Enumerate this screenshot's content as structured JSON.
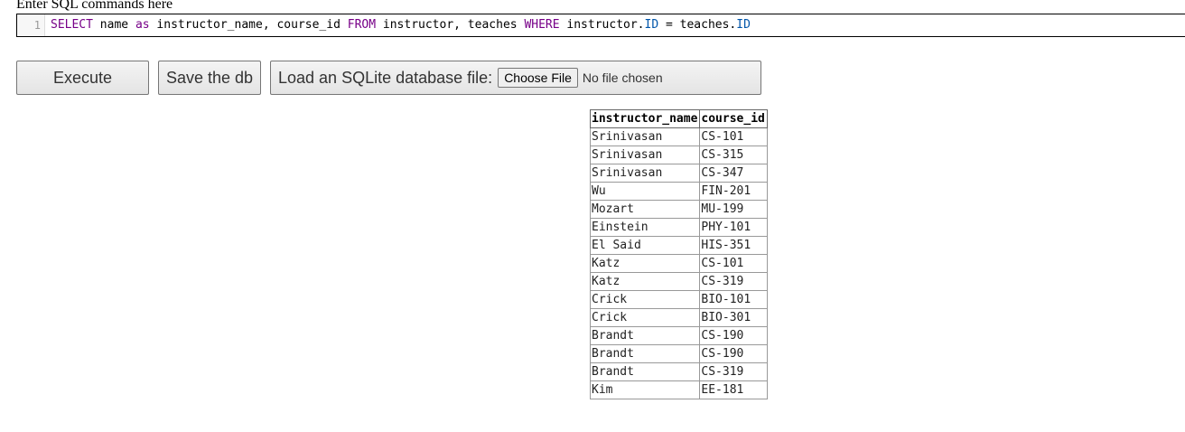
{
  "editor_label": "Enter SQL commands here",
  "editor": {
    "line_number": "1",
    "tokens": {
      "t1": "SELECT",
      "t2": " name ",
      "t3": "as",
      "t4": " instructor_name, course_id ",
      "t5": "FROM",
      "t6": " instructor, teaches ",
      "t7": "WHERE",
      "t8": " instructor.",
      "t9": "ID",
      "t10": " = teaches.",
      "t11": "ID"
    }
  },
  "toolbar": {
    "execute_label": "Execute",
    "save_label": "Save the db",
    "load_label": "Load an SQLite database file:",
    "choose_file_label": "Choose File",
    "file_status": "No file chosen"
  },
  "results": {
    "columns": [
      "instructor_name",
      "course_id"
    ],
    "rows": [
      [
        "Srinivasan",
        "CS-101"
      ],
      [
        "Srinivasan",
        "CS-315"
      ],
      [
        "Srinivasan",
        "CS-347"
      ],
      [
        "Wu",
        "FIN-201"
      ],
      [
        "Mozart",
        "MU-199"
      ],
      [
        "Einstein",
        "PHY-101"
      ],
      [
        "El Said",
        "HIS-351"
      ],
      [
        "Katz",
        "CS-101"
      ],
      [
        "Katz",
        "CS-319"
      ],
      [
        "Crick",
        "BIO-101"
      ],
      [
        "Crick",
        "BIO-301"
      ],
      [
        "Brandt",
        "CS-190"
      ],
      [
        "Brandt",
        "CS-190"
      ],
      [
        "Brandt",
        "CS-319"
      ],
      [
        "Kim",
        "EE-181"
      ]
    ]
  },
  "colors": {
    "keyword": "#770088",
    "property": "#0055aa"
  }
}
